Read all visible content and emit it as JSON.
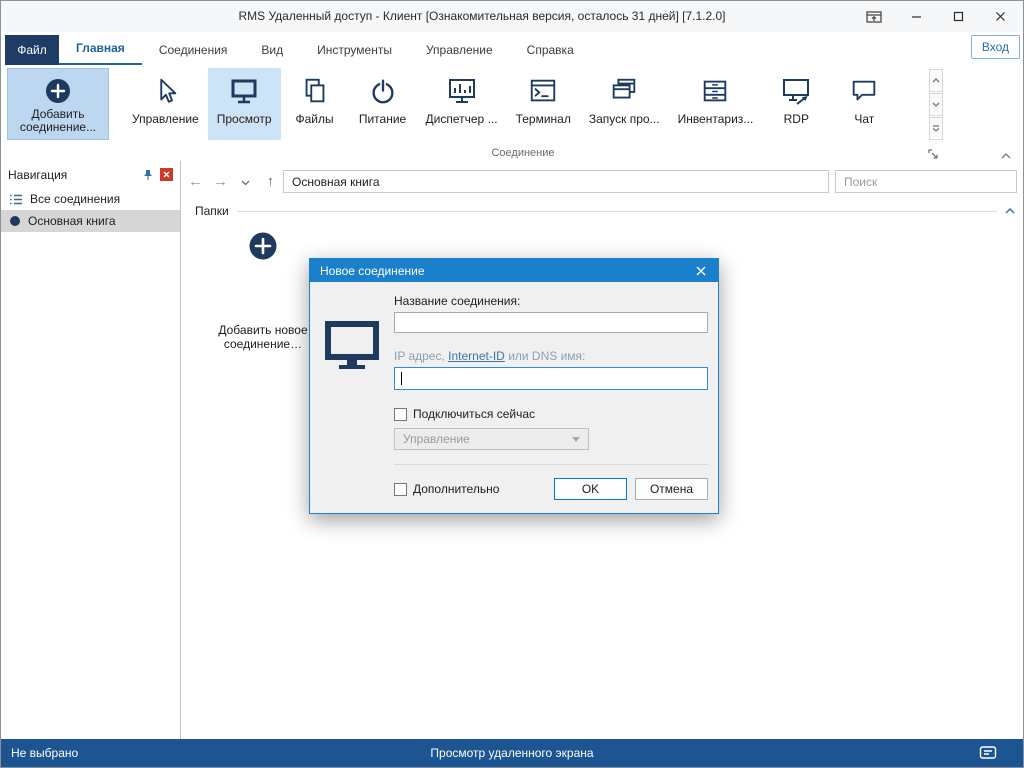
{
  "window": {
    "title": "RMS Удаленный доступ - Клиент [Ознакомительная версия, осталось 31 дней] [7.1.2.0]"
  },
  "menu": {
    "file_tab": "Файл",
    "tabs": [
      "Главная",
      "Соединения",
      "Вид",
      "Инструменты",
      "Управление",
      "Справка"
    ],
    "login_button": "Вход"
  },
  "ribbon": {
    "add_connection_button": "Добавить соединение...",
    "buttons": [
      "Управление",
      "Просмотр",
      "Файлы",
      "Питание",
      "Диспетчер ...",
      "Терминал",
      "Запуск про...",
      "Инвентариз...",
      "RDP",
      "Чат"
    ],
    "group_label": "Соединение"
  },
  "sidebar": {
    "title": "Навигация",
    "items": [
      "Все соединения",
      "Основная книга"
    ]
  },
  "toolbar": {
    "address": "Основная книга",
    "search_placeholder": "Поиск"
  },
  "content": {
    "folders_group": "Папки",
    "add_tile": "Добавить новое соединение…"
  },
  "dialog": {
    "title": "Новое соединение",
    "name_label": "Название соединения:",
    "address_prefix": "IP адрес, ",
    "address_link": "Internet-ID",
    "address_suffix": " или DNS имя:",
    "connect_now": "Подключиться сейчас",
    "mode_value": "Управление",
    "advanced": "Дополнительно",
    "ok": "OK",
    "cancel": "Отмена"
  },
  "statusbar": {
    "left": "Не выбрано",
    "center": "Просмотр удаленного экрана"
  },
  "colors": {
    "accent": "#2a6dad",
    "icon_navy": "#1e3a5f",
    "file_tab_bg": "#1f3c66",
    "dialog_header": "#1a80cc",
    "status_bar": "#1d5492",
    "ribbon_highlight": "#cde3f6"
  }
}
